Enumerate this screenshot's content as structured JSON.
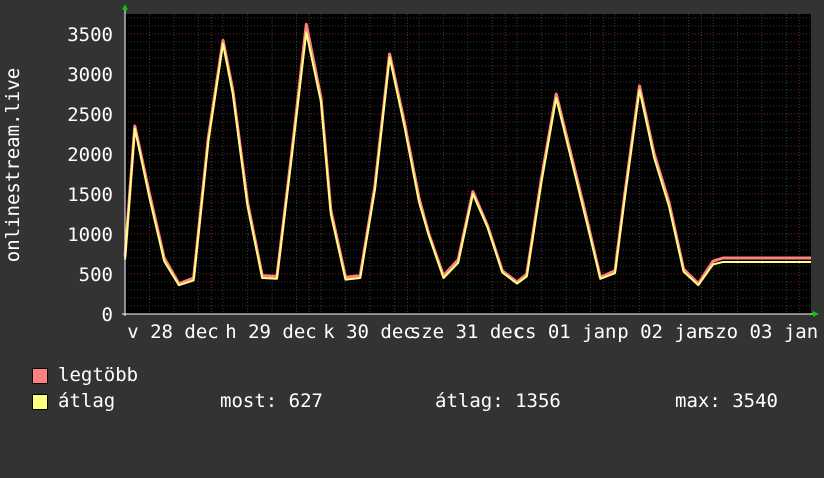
{
  "chart_data": {
    "type": "area",
    "ylabel": "onlinestream.live",
    "ylim": [
      0,
      3750
    ],
    "yticks": [
      0,
      500,
      1000,
      1500,
      2000,
      2500,
      3000,
      3500
    ],
    "x_tick_labels": [
      "v 28 dec",
      "h 29 dec",
      "k 30 dec",
      "sze 31 dec",
      "cs 01 jan",
      "p 02 jan",
      "szo 03 jan"
    ],
    "grid": true,
    "series": [
      {
        "name": "legtöbb",
        "color": "#ff8080",
        "x": [
          0,
          0.1,
          0.25,
          0.4,
          0.55,
          0.7,
          0.85,
          1.0,
          1.1,
          1.25,
          1.4,
          1.55,
          1.7,
          1.85,
          2.0,
          2.1,
          2.25,
          2.4,
          2.55,
          2.7,
          2.85,
          3.0,
          3.1,
          3.25,
          3.4,
          3.55,
          3.7,
          3.85,
          4.0,
          4.1,
          4.25,
          4.4,
          4.55,
          4.7,
          4.85,
          5.0,
          5.1,
          5.25,
          5.4,
          5.55,
          5.7,
          5.85,
          6.0,
          6.1,
          6.25,
          6.4,
          6.55,
          6.7,
          6.85,
          7.0
        ],
        "values": [
          720,
          2350,
          1500,
          700,
          380,
          450,
          2200,
          3420,
          2800,
          1400,
          480,
          470,
          2000,
          3620,
          2700,
          1300,
          460,
          480,
          1600,
          3250,
          2400,
          1450,
          1000,
          480,
          680,
          1530,
          1100,
          540,
          400,
          500,
          1700,
          2750,
          2000,
          1250,
          460,
          540,
          1500,
          2850,
          2000,
          1400,
          560,
          380,
          660,
          700,
          700,
          700,
          700,
          700,
          700,
          700
        ]
      },
      {
        "name": "átlag",
        "color": "#ffff80",
        "x": [
          0,
          0.1,
          0.25,
          0.4,
          0.55,
          0.7,
          0.85,
          1.0,
          1.1,
          1.25,
          1.4,
          1.55,
          1.7,
          1.85,
          2.0,
          2.1,
          2.25,
          2.4,
          2.55,
          2.7,
          2.85,
          3.0,
          3.1,
          3.25,
          3.4,
          3.55,
          3.7,
          3.85,
          4.0,
          4.1,
          4.25,
          4.4,
          4.55,
          4.7,
          4.85,
          5.0,
          5.1,
          5.25,
          5.4,
          5.55,
          5.7,
          5.85,
          6.0,
          6.1,
          6.25,
          6.4,
          6.55,
          6.7,
          6.85,
          7.0
        ],
        "values": [
          680,
          2320,
          1450,
          660,
          360,
          420,
          2150,
          3380,
          2750,
          1350,
          450,
          440,
          1950,
          3520,
          2650,
          1250,
          430,
          450,
          1550,
          3210,
          2350,
          1400,
          980,
          450,
          640,
          1500,
          1080,
          520,
          380,
          470,
          1650,
          2700,
          1950,
          1200,
          440,
          510,
          1450,
          2800,
          1950,
          1350,
          530,
          360,
          620,
          650,
          650,
          650,
          650,
          650,
          650,
          650
        ]
      }
    ]
  },
  "legend": [
    {
      "label": "legtöbb",
      "color": "#ff8080"
    },
    {
      "label": "átlag",
      "color": "#ffff80"
    }
  ],
  "stats": {
    "current": "most: 627",
    "average": "átlag: 1356",
    "max": "max: 3540"
  }
}
